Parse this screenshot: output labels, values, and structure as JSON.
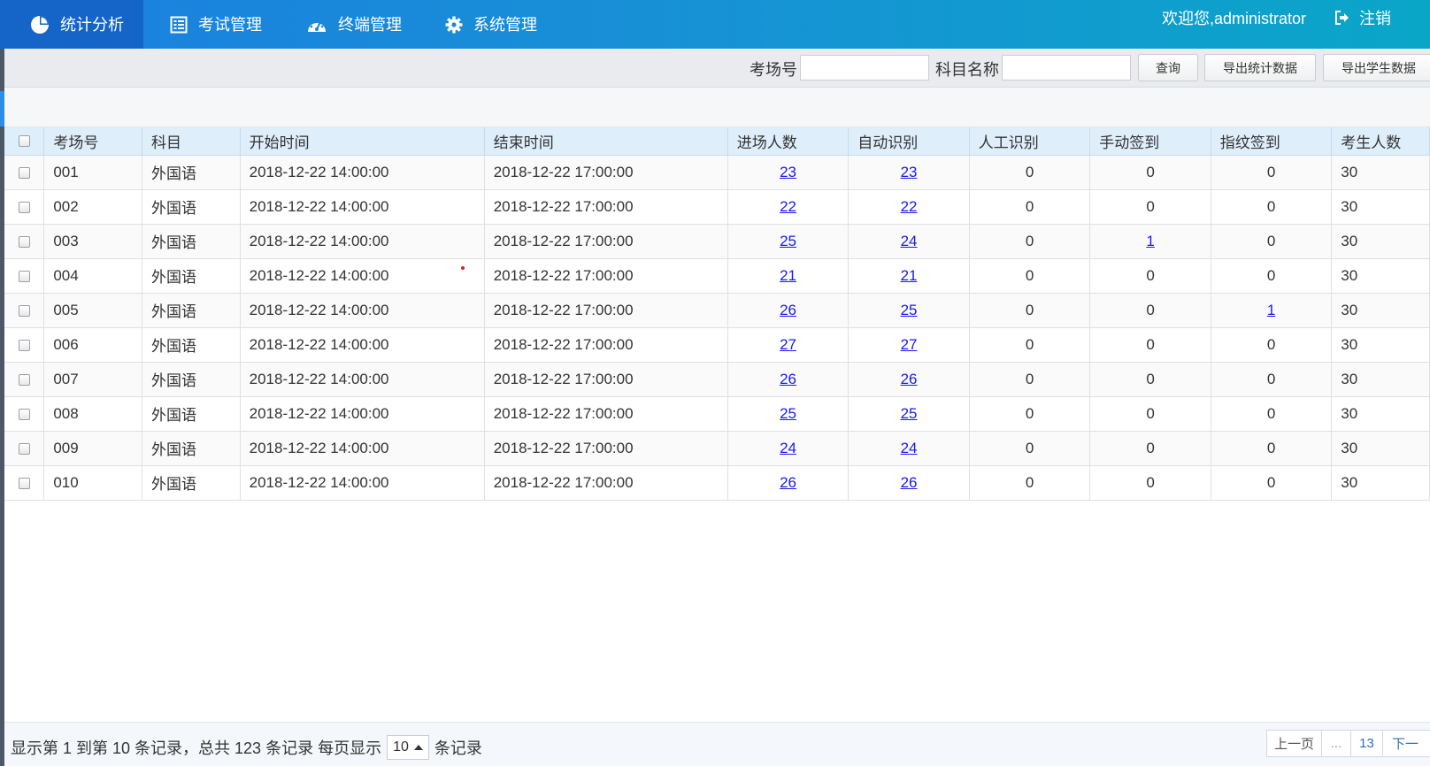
{
  "nav": {
    "items": [
      {
        "label": "统计分析",
        "icon": "pie-chart-icon"
      },
      {
        "label": "考试管理",
        "icon": "exam-list-icon"
      },
      {
        "label": "终端管理",
        "icon": "dashboard-gauge-icon"
      },
      {
        "label": "系统管理",
        "icon": "gear-icon"
      }
    ],
    "welcome": "欢迎您,administrator",
    "logout": "注销"
  },
  "search": {
    "room_label": "考场号",
    "room_value": "",
    "subject_label": "科目名称",
    "subject_value": "",
    "query_btn": "查询",
    "export_stats_btn": "导出统计数据",
    "export_students_btn": "导出学生数据"
  },
  "table": {
    "headers": [
      "考场号",
      "科目",
      "开始时间",
      "结束时间",
      "进场人数",
      "自动识别",
      "人工识别",
      "手动签到",
      "指纹签到",
      "考生人数"
    ],
    "rows": [
      [
        "001",
        "外国语",
        "2018-12-22 14:00:00",
        "2018-12-22 17:00:00",
        "23",
        "23",
        "0",
        "0",
        "0",
        "30"
      ],
      [
        "002",
        "外国语",
        "2018-12-22 14:00:00",
        "2018-12-22 17:00:00",
        "22",
        "22",
        "0",
        "0",
        "0",
        "30"
      ],
      [
        "003",
        "外国语",
        "2018-12-22 14:00:00",
        "2018-12-22 17:00:00",
        "25",
        "24",
        "0",
        "1",
        "0",
        "30"
      ],
      [
        "004",
        "外国语",
        "2018-12-22 14:00:00",
        "2018-12-22 17:00:00",
        "21",
        "21",
        "0",
        "0",
        "0",
        "30"
      ],
      [
        "005",
        "外国语",
        "2018-12-22 14:00:00",
        "2018-12-22 17:00:00",
        "26",
        "25",
        "0",
        "0",
        "1",
        "30"
      ],
      [
        "006",
        "外国语",
        "2018-12-22 14:00:00",
        "2018-12-22 17:00:00",
        "27",
        "27",
        "0",
        "0",
        "0",
        "30"
      ],
      [
        "007",
        "外国语",
        "2018-12-22 14:00:00",
        "2018-12-22 17:00:00",
        "26",
        "26",
        "0",
        "0",
        "0",
        "30"
      ],
      [
        "008",
        "外国语",
        "2018-12-22 14:00:00",
        "2018-12-22 17:00:00",
        "25",
        "25",
        "0",
        "0",
        "0",
        "30"
      ],
      [
        "009",
        "外国语",
        "2018-12-22 14:00:00",
        "2018-12-22 17:00:00",
        "24",
        "24",
        "0",
        "0",
        "0",
        "30"
      ],
      [
        "010",
        "外国语",
        "2018-12-22 14:00:00",
        "2018-12-22 17:00:00",
        "26",
        "26",
        "0",
        "0",
        "0",
        "30"
      ]
    ]
  },
  "footer": {
    "summary": "显示第 1 到第 10 条记录，总共 123 条记录 每页显示",
    "page_size": "10",
    "suffix": "条记录",
    "prev": "上一页",
    "ellipsis": "...",
    "last_page": "13",
    "next": "下一"
  },
  "colors": {
    "nav_gradient_start": "#1a7fe0",
    "nav_gradient_end": "#0aa6c8",
    "nav_active": "#1565c8",
    "header_row": "#dfeefb",
    "link": "#1a1aee"
  }
}
